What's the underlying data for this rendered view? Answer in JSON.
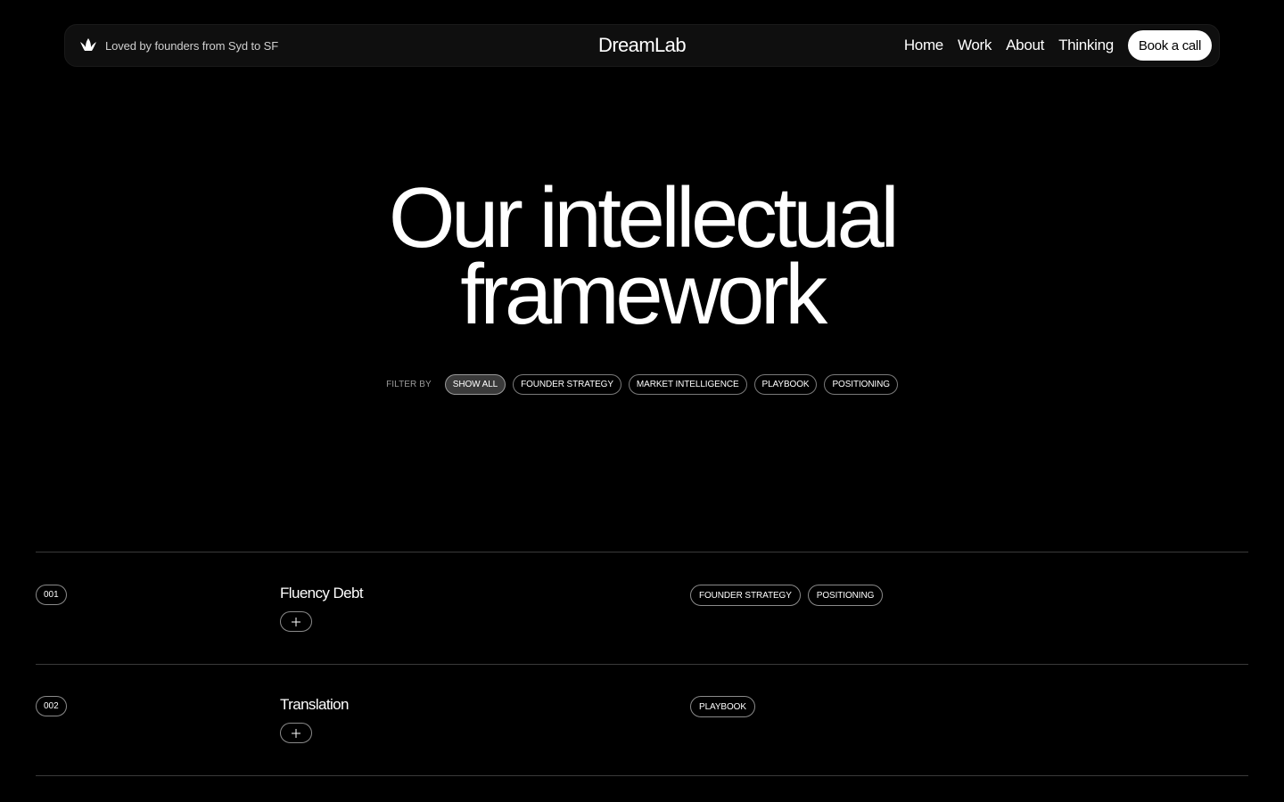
{
  "header": {
    "tagline": "Loved by founders from Syd to SF",
    "tagline_icon": "leaf-crown-icon",
    "brand": "DreamLab",
    "nav": [
      {
        "label": "Home"
      },
      {
        "label": "Work"
      },
      {
        "label": "About"
      },
      {
        "label": "Thinking"
      }
    ],
    "cta_label": "Book a call"
  },
  "hero": {
    "title_line1": "Our intellectual",
    "title_line2": "framework"
  },
  "filters": {
    "label": "FILTER BY",
    "options": [
      {
        "label": "SHOW ALL",
        "active": true
      },
      {
        "label": "FOUNDER STRATEGY",
        "active": false
      },
      {
        "label": "MARKET INTELLIGENCE",
        "active": false
      },
      {
        "label": "PLAYBOOK",
        "active": false
      },
      {
        "label": "POSITIONING",
        "active": false
      }
    ]
  },
  "items": [
    {
      "number": "001",
      "title": "Fluency Debt",
      "tags": [
        "FOUNDER STRATEGY",
        "POSITIONING"
      ]
    },
    {
      "number": "002",
      "title": "Translation",
      "tags": [
        "PLAYBOOK"
      ]
    }
  ],
  "colors": {
    "background": "#000000",
    "text": "#ffffff",
    "header_bg": "#0f0f0f",
    "active_chip_bg": "#3a3a3a",
    "divider": "#3a3a3a"
  }
}
